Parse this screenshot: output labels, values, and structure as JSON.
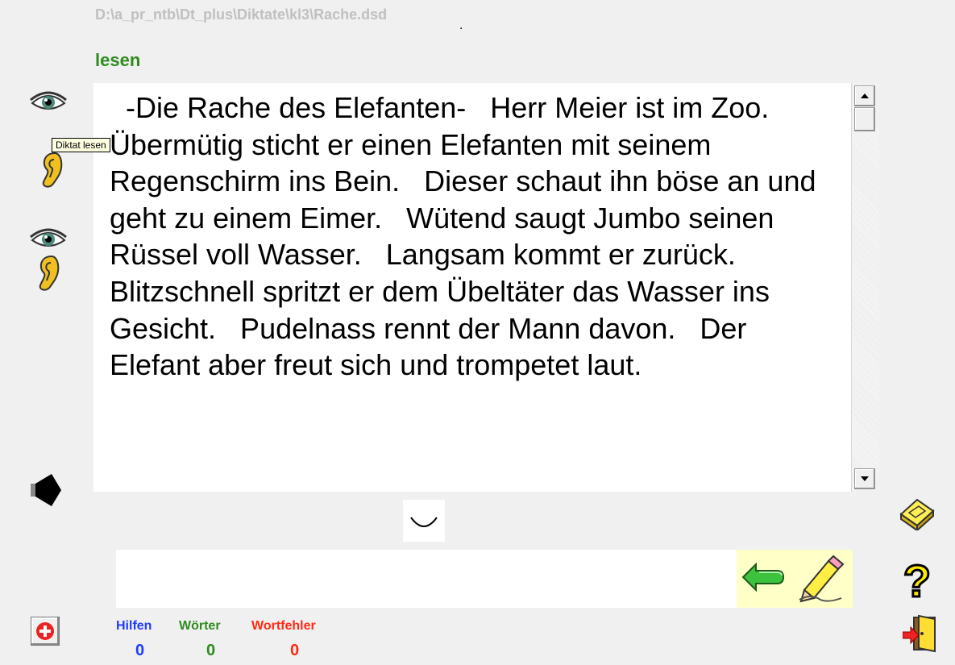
{
  "window": {
    "file_path": "D:\\a_pr_ntb\\Dt_plus\\Diktate\\kl3\\Rache.dsd",
    "mode_label": "lesen"
  },
  "dictation": {
    "text": "  -Die Rache des Elefanten-   Herr Meier ist im Zoo.   Übermütig sticht er einen Elefanten mit seinem Regenschirm ins Bein.   Dieser schaut ihn böse an und geht zu einem Eimer.   Wütend saugt Jumbo seinen Rüssel voll Wasser.   Langsam kommt er zurück.   Blitzschnell spritzt er dem Übeltäter das Wasser ins Gesicht.   Pudelnass rennt der Mann davon.   Der Elefant aber freut sich und trompetet laut."
  },
  "tooltip": {
    "text": "Diktat lesen"
  },
  "input": {
    "value": ""
  },
  "stats": {
    "hints_label": "Hilfen",
    "hints_value": "0",
    "words_label": "Wörter",
    "words_value": "0",
    "errors_label": "Wortfehler",
    "errors_value": "0"
  },
  "colors": {
    "mode_green": "#2e8b1e",
    "hints_blue": "#1e3cff",
    "words_green": "#2e8b1e",
    "errors_red": "#ff2a14",
    "action_panel": "#ffffc8"
  },
  "icons": {
    "left_toolbar": [
      "eye-icon",
      "ear-icon",
      "eye-ear-icon",
      "speaker-icon"
    ],
    "right_toolbar": [
      "eraser-icon",
      "help-icon",
      "exit-door-icon"
    ],
    "action_panel": [
      "enter-arrow-icon",
      "pencil-icon"
    ],
    "bottom_left": [
      "first-aid-icon"
    ]
  }
}
